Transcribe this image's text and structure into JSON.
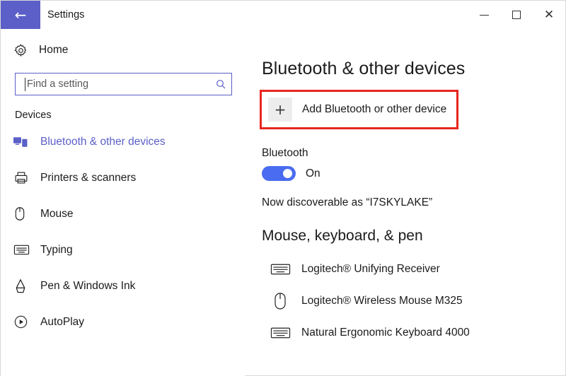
{
  "window": {
    "title": "Settings",
    "back_icon": "back-arrow-icon",
    "caption": {
      "minimize": "minimize-icon",
      "maximize": "maximize-icon",
      "close": "close-icon"
    }
  },
  "sidebar": {
    "home": {
      "label": "Home",
      "icon": "gear-icon"
    },
    "search": {
      "placeholder": "Find a setting",
      "value": "",
      "icon": "search-icon"
    },
    "group_heading": "Devices",
    "items": [
      {
        "label": "Bluetooth & other devices",
        "icon": "bluetooth-devices-icon",
        "selected": true
      },
      {
        "label": "Printers & scanners",
        "icon": "printer-icon",
        "selected": false
      },
      {
        "label": "Mouse",
        "icon": "mouse-icon",
        "selected": false
      },
      {
        "label": "Typing",
        "icon": "keyboard-icon",
        "selected": false
      },
      {
        "label": "Pen & Windows Ink",
        "icon": "pen-icon",
        "selected": false
      },
      {
        "label": "AutoPlay",
        "icon": "autoplay-icon",
        "selected": false
      }
    ]
  },
  "main": {
    "page_title": "Bluetooth & other devices",
    "add_device": {
      "label": "Add Bluetooth or other device",
      "icon": "plus-icon",
      "highlight_color": "#e8251f"
    },
    "bluetooth": {
      "section_label": "Bluetooth",
      "toggle_state": "On",
      "toggle_on": true,
      "toggle_color": "#4a6cf0",
      "discoverable_text": "Now discoverable as “I7SKYLAKE”"
    },
    "peripherals": {
      "heading": "Mouse, keyboard, & pen",
      "devices": [
        {
          "name": "Logitech® Unifying Receiver",
          "icon": "keyboard-icon"
        },
        {
          "name": "Logitech® Wireless Mouse M325",
          "icon": "mouse-icon"
        },
        {
          "name": "Natural Ergonomic Keyboard 4000",
          "icon": "keyboard-icon"
        }
      ]
    }
  },
  "accent_color": "#5b5fc7"
}
